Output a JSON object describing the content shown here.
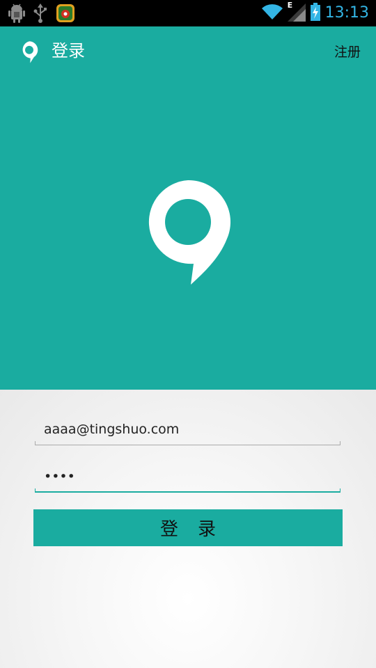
{
  "status_bar": {
    "time": "13:13",
    "network_label": "E",
    "icons": [
      "android-debug-icon",
      "usb-icon",
      "app-notification-icon",
      "wifi-icon",
      "signal-icon",
      "battery-charging-icon"
    ]
  },
  "action_bar": {
    "title": "登录",
    "register_label": "注册",
    "logo_icon": "speech-bubble-logo-icon"
  },
  "hero": {
    "logo_icon": "speech-bubble-logo-icon"
  },
  "form": {
    "email_value": "aaaa@tingshuo.com",
    "password_value": "aaaa",
    "login_label": "登录"
  },
  "colors": {
    "brand": "#1aaca0",
    "status_accent": "#33b5e5"
  }
}
